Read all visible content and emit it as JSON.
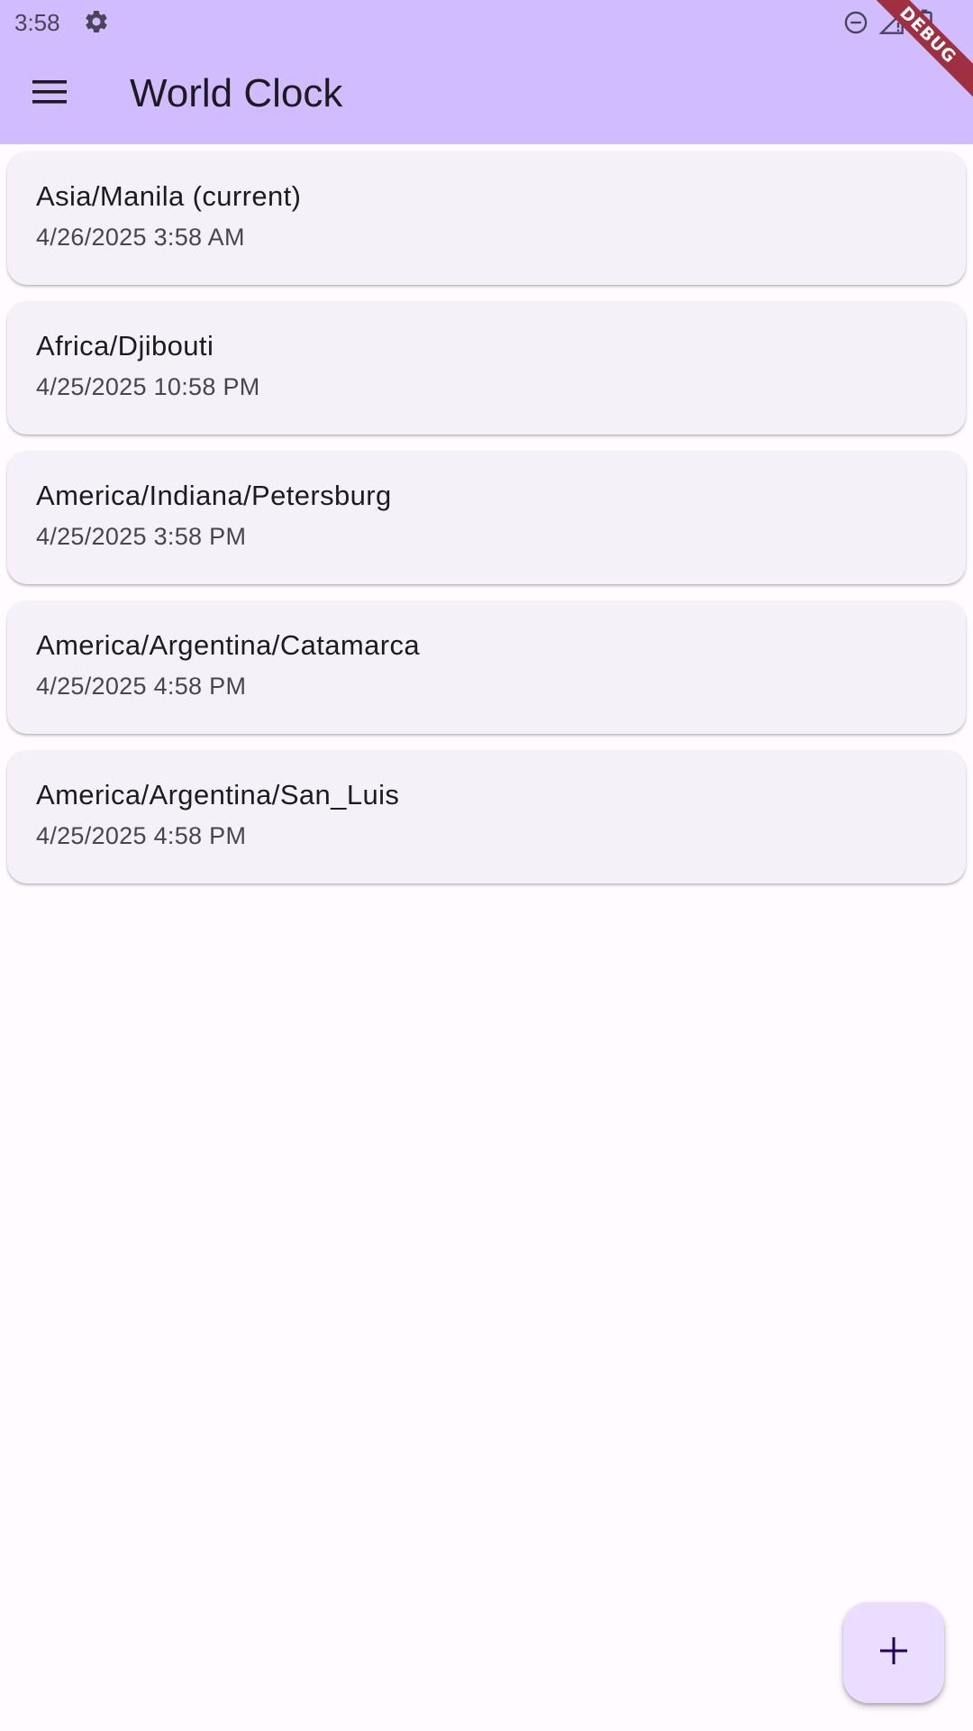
{
  "status_bar": {
    "time": "3:58",
    "icons": [
      "settings-gear-icon",
      "do-not-disturb-icon",
      "signal-icon",
      "battery-icon"
    ]
  },
  "app_bar": {
    "title": "World Clock",
    "menu_icon": "hamburger-menu-icon",
    "background": "#D0BCFF"
  },
  "debug_banner": {
    "label": "DEBUG"
  },
  "clocks": [
    {
      "zone": "Asia/Manila (current)",
      "datetime": "4/26/2025 3:58 AM"
    },
    {
      "zone": "Africa/Djibouti",
      "datetime": "4/25/2025 10:58 PM"
    },
    {
      "zone": "America/Indiana/Petersburg",
      "datetime": "4/25/2025 3:58 PM"
    },
    {
      "zone": "America/Argentina/Catamarca",
      "datetime": "4/25/2025 4:58 PM"
    },
    {
      "zone": "America/Argentina/San_Luis",
      "datetime": "4/25/2025 4:58 PM"
    }
  ],
  "fab": {
    "icon": "plus-icon",
    "background": "#EADDFF"
  },
  "colors": {
    "card_background": "#F5F1F8",
    "page_background": "#FFFBFF",
    "fab_icon": "#21005D"
  }
}
